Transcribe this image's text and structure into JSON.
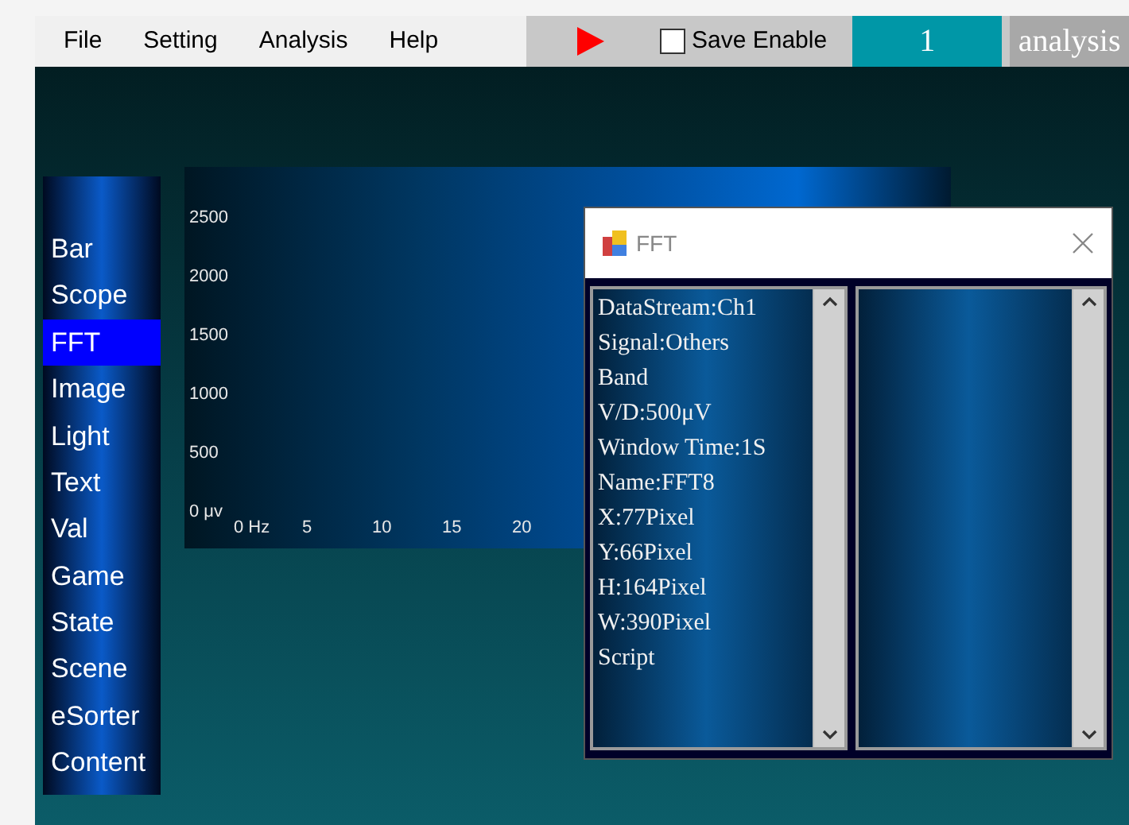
{
  "menu": [
    "File",
    "Setting",
    "Analysis",
    "Help"
  ],
  "toolbar": {
    "running": false,
    "save_enable": {
      "label": "Save Enable",
      "checked": false
    },
    "counter": "1",
    "mode": "analysis"
  },
  "sidebar": {
    "items": [
      {
        "label": "Bar",
        "selected": false
      },
      {
        "label": "Scope",
        "selected": false
      },
      {
        "label": "FFT",
        "selected": true
      },
      {
        "label": "Image",
        "selected": false
      },
      {
        "label": "Light",
        "selected": false
      },
      {
        "label": "Text",
        "selected": false
      },
      {
        "label": "Val",
        "selected": false
      },
      {
        "label": "Game",
        "selected": false
      },
      {
        "label": "State",
        "selected": false
      },
      {
        "label": "Scene",
        "selected": false
      },
      {
        "label": "eSorter",
        "selected": false
      },
      {
        "label": "Content",
        "selected": false
      }
    ]
  },
  "plot": {
    "y_labels": [
      "2500",
      "2000",
      "1500",
      "1000",
      "500",
      "0 μv"
    ],
    "x_labels": [
      "0 Hz",
      "5",
      "10",
      "15",
      "20"
    ]
  },
  "dialog": {
    "title": "FFT",
    "properties": [
      "DataStream:Ch1",
      "Signal:Others",
      "Band",
      "V/D:500μV",
      "Window Time:1S",
      "Name:FFT8",
      "X:77Pixel",
      "Y:66Pixel",
      "H:164Pixel",
      "W:390Pixel",
      "Script"
    ]
  }
}
